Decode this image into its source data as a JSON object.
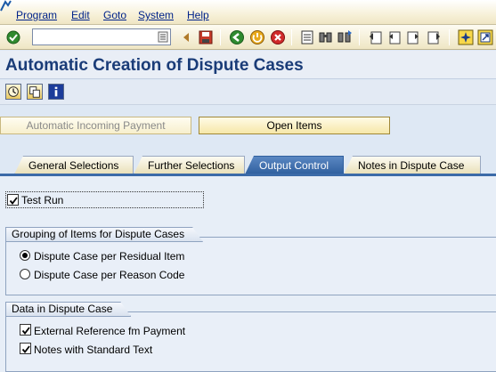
{
  "menu": {
    "items": [
      {
        "label": "Program"
      },
      {
        "label": "Edit"
      },
      {
        "label": "Goto"
      },
      {
        "label": "System"
      },
      {
        "label": "Help"
      }
    ]
  },
  "toolbar": {
    "command_field": {
      "value": "",
      "placeholder": ""
    },
    "icons": [
      "enter-icon",
      "dropdown-icon",
      "back-arrow-icon",
      "save-icon",
      "back-icon",
      "exit-icon",
      "cancel-icon",
      "print-icon",
      "find-icon",
      "find-next-icon",
      "first-page-icon",
      "previous-page-icon",
      "next-page-icon",
      "last-page-icon",
      "create-session-icon",
      "shortcut-icon"
    ]
  },
  "title": "Automatic Creation of Dispute Cases",
  "app_toolbar": {
    "icons": [
      "execute-icon",
      "get-variant-icon",
      "info-icon"
    ]
  },
  "buttons": {
    "automatic_incoming_payment": "Automatic Incoming Payment",
    "open_items": "Open Items"
  },
  "tabs": [
    {
      "label": "General Selections",
      "active": false
    },
    {
      "label": "Further Selections",
      "active": false
    },
    {
      "label": "Output Control",
      "active": true
    },
    {
      "label": "Notes in Dispute Case",
      "active": false
    }
  ],
  "test_run": {
    "label": "Test Run",
    "checked": true
  },
  "grouping": {
    "title": "Grouping of Items for Dispute Cases",
    "options": [
      {
        "label": "Dispute Case per Residual Item",
        "selected": true
      },
      {
        "label": "Dispute Case per Reason Code",
        "selected": false
      }
    ]
  },
  "dispute_data": {
    "title": "Data in Dispute Case",
    "options": [
      {
        "label": "External Reference fm Payment",
        "checked": true
      },
      {
        "label": "Notes with Standard Text",
        "checked": true
      }
    ]
  },
  "colors": {
    "title": "#1a3c78",
    "menu_text": "#00238a",
    "active_tab": "#2f5f9e",
    "background": "#dee8f4"
  }
}
